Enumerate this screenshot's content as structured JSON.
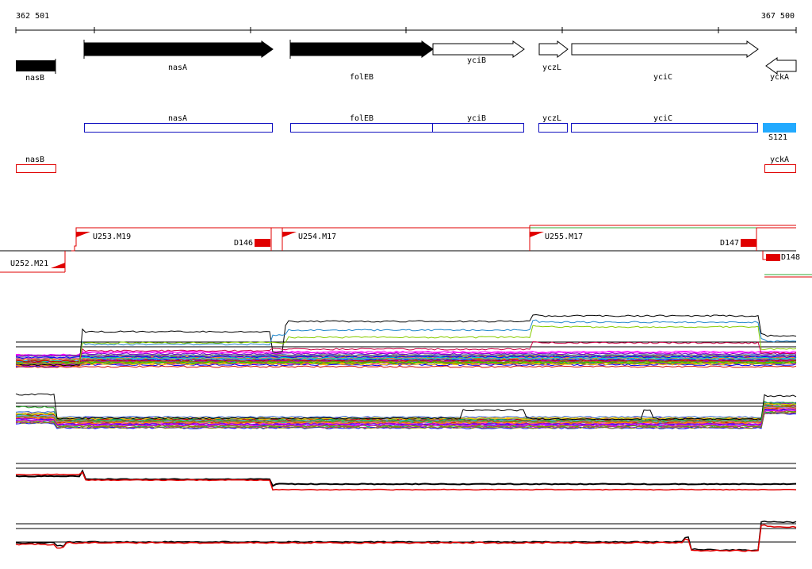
{
  "coordinates": {
    "start": "362 501",
    "end": "367 500"
  },
  "annotated_genes": [
    {
      "name": "nasB",
      "strand": "-",
      "filled": true
    },
    {
      "name": "nasA",
      "strand": "+",
      "filled": true
    },
    {
      "name": "folEB",
      "strand": "+",
      "filled": true
    },
    {
      "name": "yciB",
      "strand": "+",
      "filled": false
    },
    {
      "name": "yczL",
      "strand": "+",
      "filled": false
    },
    {
      "name": "yciC",
      "strand": "+",
      "filled": false
    },
    {
      "name": "yckA",
      "strand": "-",
      "filled": false
    }
  ],
  "plus_strand_features": [
    "nasA",
    "folEB",
    "yciB",
    "yczL",
    "yciC"
  ],
  "plus_strand_segment": {
    "name": "S121",
    "color": "#22aaff"
  },
  "minus_strand_features": [
    "nasB",
    "yckA"
  ],
  "upshifts": [
    "U252.M21",
    "U253.M19",
    "U254.M17",
    "U255.M17"
  ],
  "downshifts": [
    "D146",
    "D147",
    "D148"
  ],
  "colors": {
    "annotation_fill": "#000000",
    "plus_feature": "#1010c0",
    "minus_feature": "#e00000",
    "segment": "#22aaff",
    "marker": "#ff0000",
    "plus_axis": "#000000",
    "profile_black": "#000000",
    "profile_red": "#e00000"
  }
}
